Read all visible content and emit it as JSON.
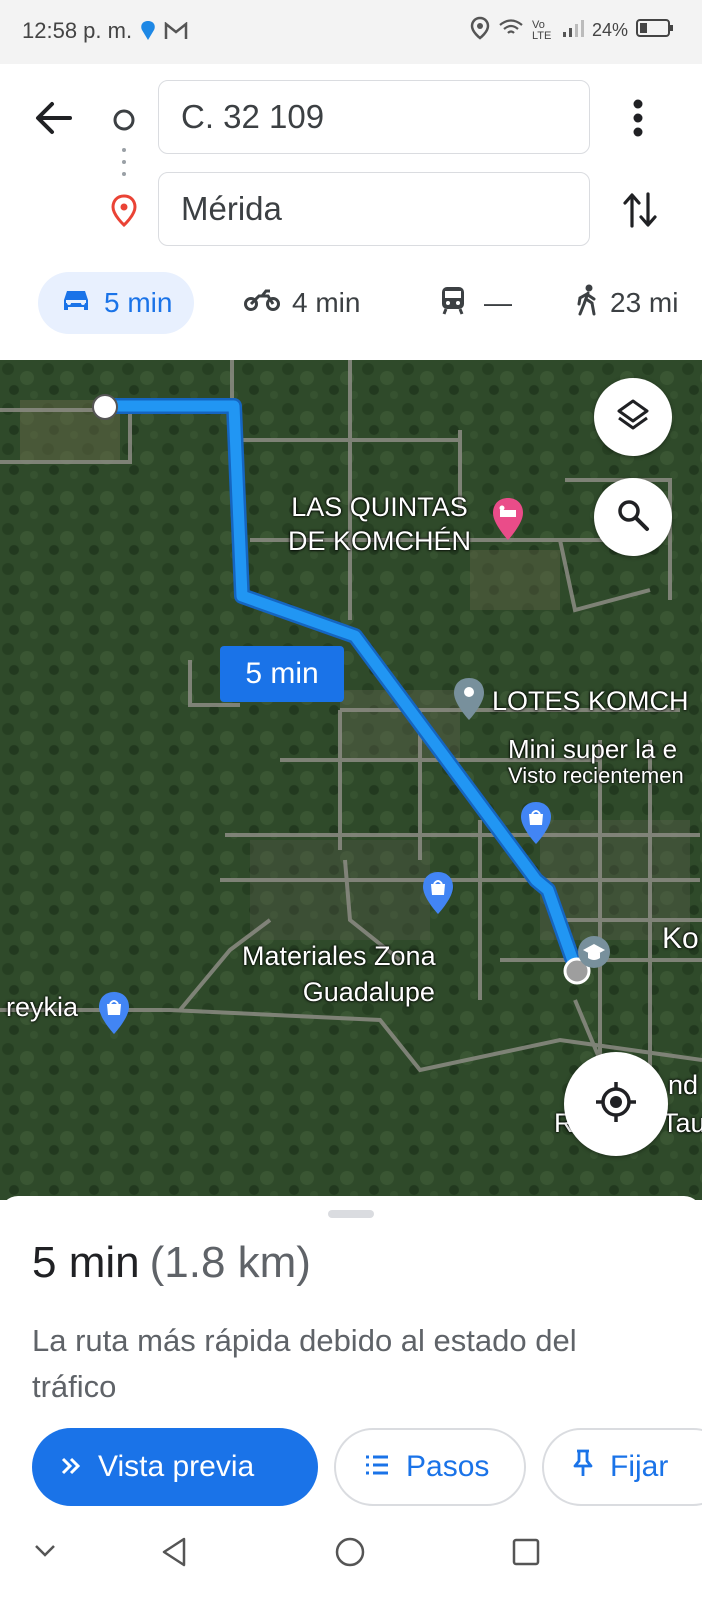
{
  "status_bar": {
    "time": "12:58 p. m.",
    "volte": "Vo LTE",
    "battery": "24%"
  },
  "route": {
    "origin": "C. 32 109",
    "destination": "Mérida"
  },
  "modes": [
    {
      "icon": "car-icon",
      "label": "5 min",
      "active": true
    },
    {
      "icon": "motorcycle-icon",
      "label": "4 min"
    },
    {
      "icon": "transit-icon",
      "label": "—"
    },
    {
      "icon": "walk-icon",
      "label": "23 mi"
    }
  ],
  "map": {
    "route_time_badge": "5 min",
    "places": [
      {
        "lines": [
          "LAS QUINTAS",
          "DE KOMCHÉN"
        ],
        "icon": "hotel-pin-icon"
      },
      {
        "lines": [
          "LOTES KOMCH"
        ],
        "icon": "place-pin-icon"
      },
      {
        "lines": [
          "Mini super la e",
          "Visto recientemen"
        ],
        "icon": "shopping-pin-icon"
      },
      {
        "lines": [
          "Materiales Zona",
          "Guadalupe"
        ],
        "icon": "shopping-pin-icon"
      },
      {
        "lines": [
          "reykia"
        ],
        "icon": "shopping-pin-icon"
      },
      {
        "lines": [
          "Ko"
        ]
      },
      {
        "lines": [
          "nd",
          "R",
          "Tau"
        ]
      }
    ]
  },
  "sheet": {
    "duration": "5 min",
    "distance": "(1.8 km)",
    "description": "La ruta más rápida debido al estado del tráfico",
    "buttons": {
      "preview": "Vista previa",
      "steps": "Pasos",
      "pin": "Fijar"
    }
  },
  "colors": {
    "accent": "#1a73e8",
    "route": "#2196f3",
    "map_bg": "#2f4a2a"
  }
}
